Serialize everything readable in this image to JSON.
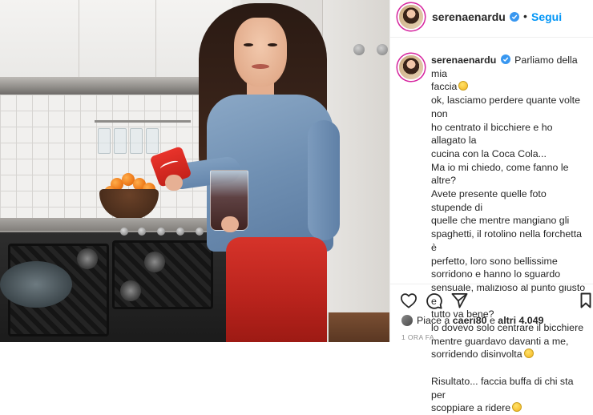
{
  "post": {
    "username": "serenaenardu",
    "follow_label": "Segui",
    "separator": "•",
    "caption": {
      "username": "serenaenardu",
      "lines": [
        "Parliamo della mia",
        "faccia",
        "ok, lasciamo perdere quante volte non",
        "ho centrato il bicchiere e ho allagato la",
        "cucina con la Coca Cola...",
        "Ma io mi chiedo, come fanno le altre?",
        "Avete presente quelle foto stupende di",
        "quelle che mentre mangiano gli",
        "spaghetti, il rotolino nella forchetta è",
        "perfetto, loro sono bellissime",
        "sorridono e hanno lo sguardo",
        "sensuale, malizioso al punto giusto e",
        "tutto va bene?",
        "lo dovevo solo centrare il bicchiere",
        "mentre guardavo davanti a me,",
        "sorridendo disinvolta",
        "Risultato... faccia buffa di chi sta per",
        "scoppiare a ridere"
      ]
    },
    "likes": {
      "prefix": "Piace a ",
      "user": "caeri80",
      "middle": " e ",
      "others": "altri 4.049"
    },
    "time": "1 ORA FA"
  },
  "icons": {
    "verified": "verified-badge-icon",
    "like": "heart-icon",
    "comment": "comment-icon",
    "share": "paper-plane-icon",
    "save": "bookmark-icon",
    "emoji": "emoji-icon"
  },
  "colors": {
    "accent": "#0095f6",
    "verified": "#3897f0",
    "text": "#262626",
    "muted": "#8e8e8e"
  }
}
